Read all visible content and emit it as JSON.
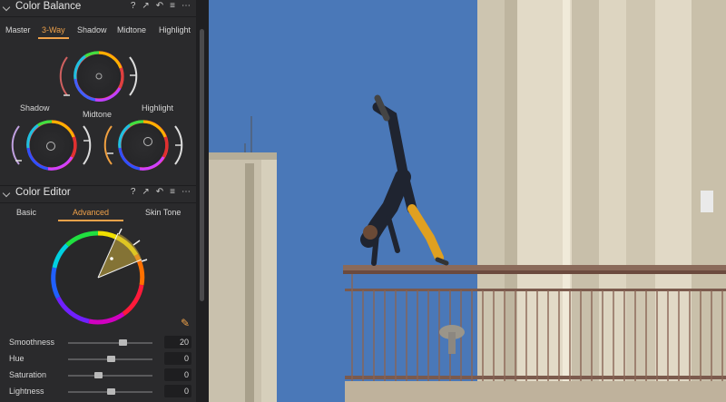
{
  "color_balance": {
    "title": "Color Balance",
    "header_icons": [
      "?",
      "↗",
      "↶",
      "≡",
      "⋯"
    ],
    "tabs": [
      "Master",
      "3-Way",
      "Shadow",
      "Midtone",
      "Highlight"
    ],
    "active_tab": "3-Way",
    "wheel_labels": {
      "shadow": "Shadow",
      "midtone": "Midtone",
      "highlight": "Highlight"
    }
  },
  "color_editor": {
    "title": "Color Editor",
    "header_icons": [
      "?",
      "↗",
      "↶",
      "≡",
      "⋯"
    ],
    "tabs": [
      "Basic",
      "Advanced",
      "Skin Tone"
    ],
    "active_tab": "Advanced",
    "picker_icon": "color-picker-icon",
    "sliders": [
      {
        "label": "Smoothness",
        "value": "20",
        "level": 0.65
      },
      {
        "label": "Hue",
        "value": "0",
        "level": 0.5
      },
      {
        "label": "Saturation",
        "value": "0",
        "level": 0.35
      },
      {
        "label": "Lightness",
        "value": "0",
        "level": 0.5
      }
    ]
  },
  "colors": {
    "accent": "#f0a24a",
    "panel_bg": "#2a2a2c",
    "sky": "#4a76b6"
  }
}
